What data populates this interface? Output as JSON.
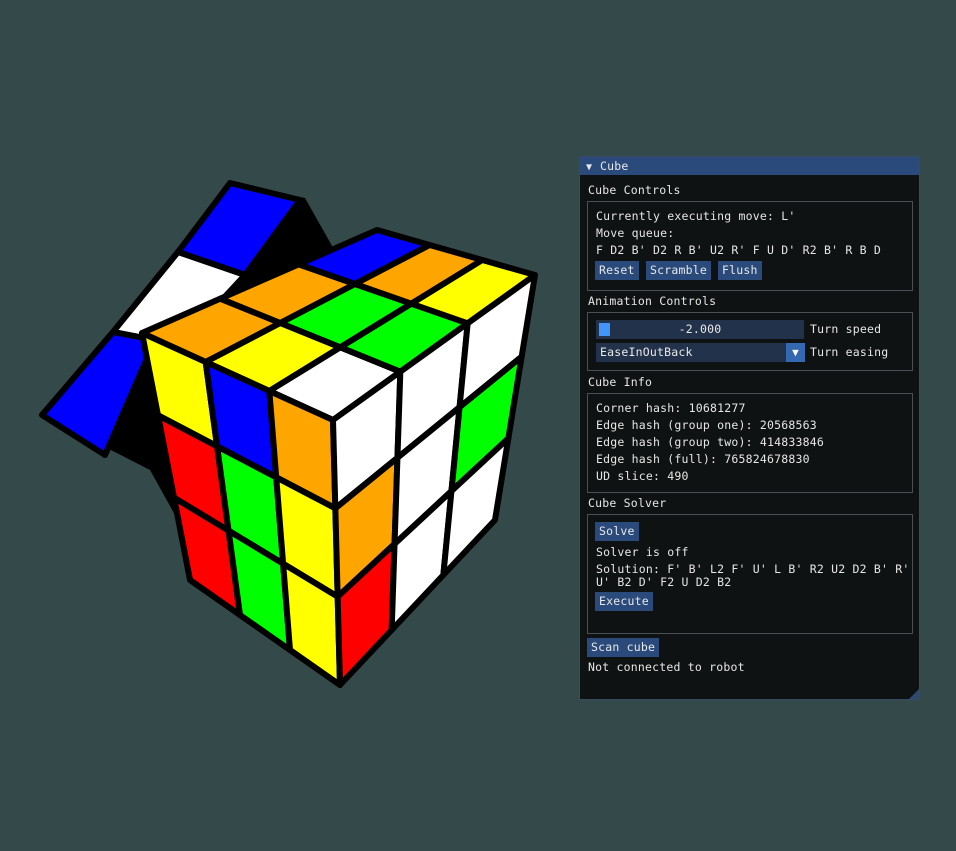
{
  "colors": {
    "background": "#344a4a",
    "white": "#ffffff",
    "yellow": "#ffff00",
    "blue": "#0000ff",
    "green": "#00ff00",
    "red": "#ff0000",
    "orange": "#ffa500"
  },
  "window": {
    "title": "Cube",
    "collapse_icon": "triangle-down-icon"
  },
  "cube_controls": {
    "header": "Cube Controls",
    "current_move": "Currently executing move: L'",
    "queue_label": "Move queue:",
    "queue": "F D2 B' D2 R B' U2 R' F U D' R2 B' R B D",
    "reset_label": "Reset",
    "scramble_label": "Scramble",
    "flush_label": "Flush"
  },
  "animation_controls": {
    "header": "Animation Controls",
    "turn_speed_value": "-2.000",
    "turn_speed_label": "Turn speed",
    "turn_easing_value": "EaseInOutBack",
    "turn_easing_label": "Turn easing"
  },
  "cube_info": {
    "header": "Cube Info",
    "corner_hash": "Corner hash: 10681277",
    "edge_hash_one": "Edge hash (group one): 20568563",
    "edge_hash_two": "Edge hash (group two): 414833846",
    "edge_hash_full": "Edge hash (full): 765824678830",
    "ud_slice": "UD slice: 490"
  },
  "cube_solver": {
    "header": "Cube Solver",
    "solve_label": "Solve",
    "status": "Solver is off",
    "solution_line1": "Solution: F' B' L2 F' U' L B' R2 U2 D2 B' R'",
    "solution_line2": "U' B2 D' F2 U D2 B2",
    "execute_label": "Execute"
  },
  "scan_cube_label": "Scan cube",
  "robot_status": "Not connected to robot",
  "cube_faces": {
    "top": [
      "orange",
      "orange",
      "blue",
      "yellow",
      "green",
      "orange",
      "white",
      "green",
      "yellow"
    ],
    "front": [
      "yellow",
      "blue",
      "orange",
      "red",
      "green",
      "yellow",
      "red",
      "green",
      "yellow"
    ],
    "right": [
      "white",
      "white",
      "white",
      "orange",
      "white",
      "green",
      "red",
      "white",
      "white"
    ],
    "rotating_layer": [
      "blue",
      "white",
      "blue"
    ]
  }
}
